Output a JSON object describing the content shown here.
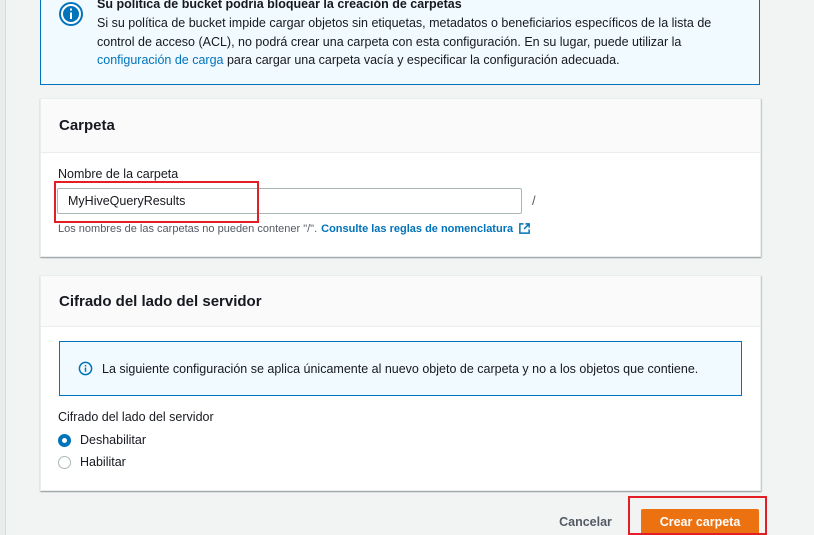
{
  "banner": {
    "title": "Su política de bucket podría bloquear la creación de carpetas",
    "text_before_link": "Si su política de bucket impide cargar objetos sin etiquetas, metadatos o beneficiarios específicos de la lista de control de acceso (ACL), no podrá crear una carpeta con esta configuración. En su lugar, puede utilizar la ",
    "link_text": "configuración de carga",
    "text_after_link": " para cargar una carpeta vacía y especificar la configuración adecuada.",
    "icon": "info-icon",
    "accent_color": "#0073bb"
  },
  "folder_panel": {
    "title": "Carpeta",
    "field_label": "Nombre de la carpeta",
    "field_value": "MyHiveQueryResults",
    "separator": "/",
    "hint_text": "Los nombres de las carpetas no pueden contener \"/\".",
    "hint_link": "Consulte las reglas de nomenclatura",
    "hint_link_icon": "external-link-icon"
  },
  "encryption_panel": {
    "title": "Cifrado del lado del servidor",
    "info_text": "La siguiente configuración se aplica únicamente al nuevo objeto de carpeta y no a los objetos que contiene.",
    "group_label": "Cifrado del lado del servidor",
    "options": [
      {
        "label": "Deshabilitar",
        "selected": true
      },
      {
        "label": "Habilitar",
        "selected": false
      }
    ]
  },
  "actions": {
    "cancel_label": "Cancelar",
    "create_label": "Crear carpeta",
    "primary_color": "#ec7211"
  },
  "annotations": {
    "highlight_color": "#e31e24"
  }
}
